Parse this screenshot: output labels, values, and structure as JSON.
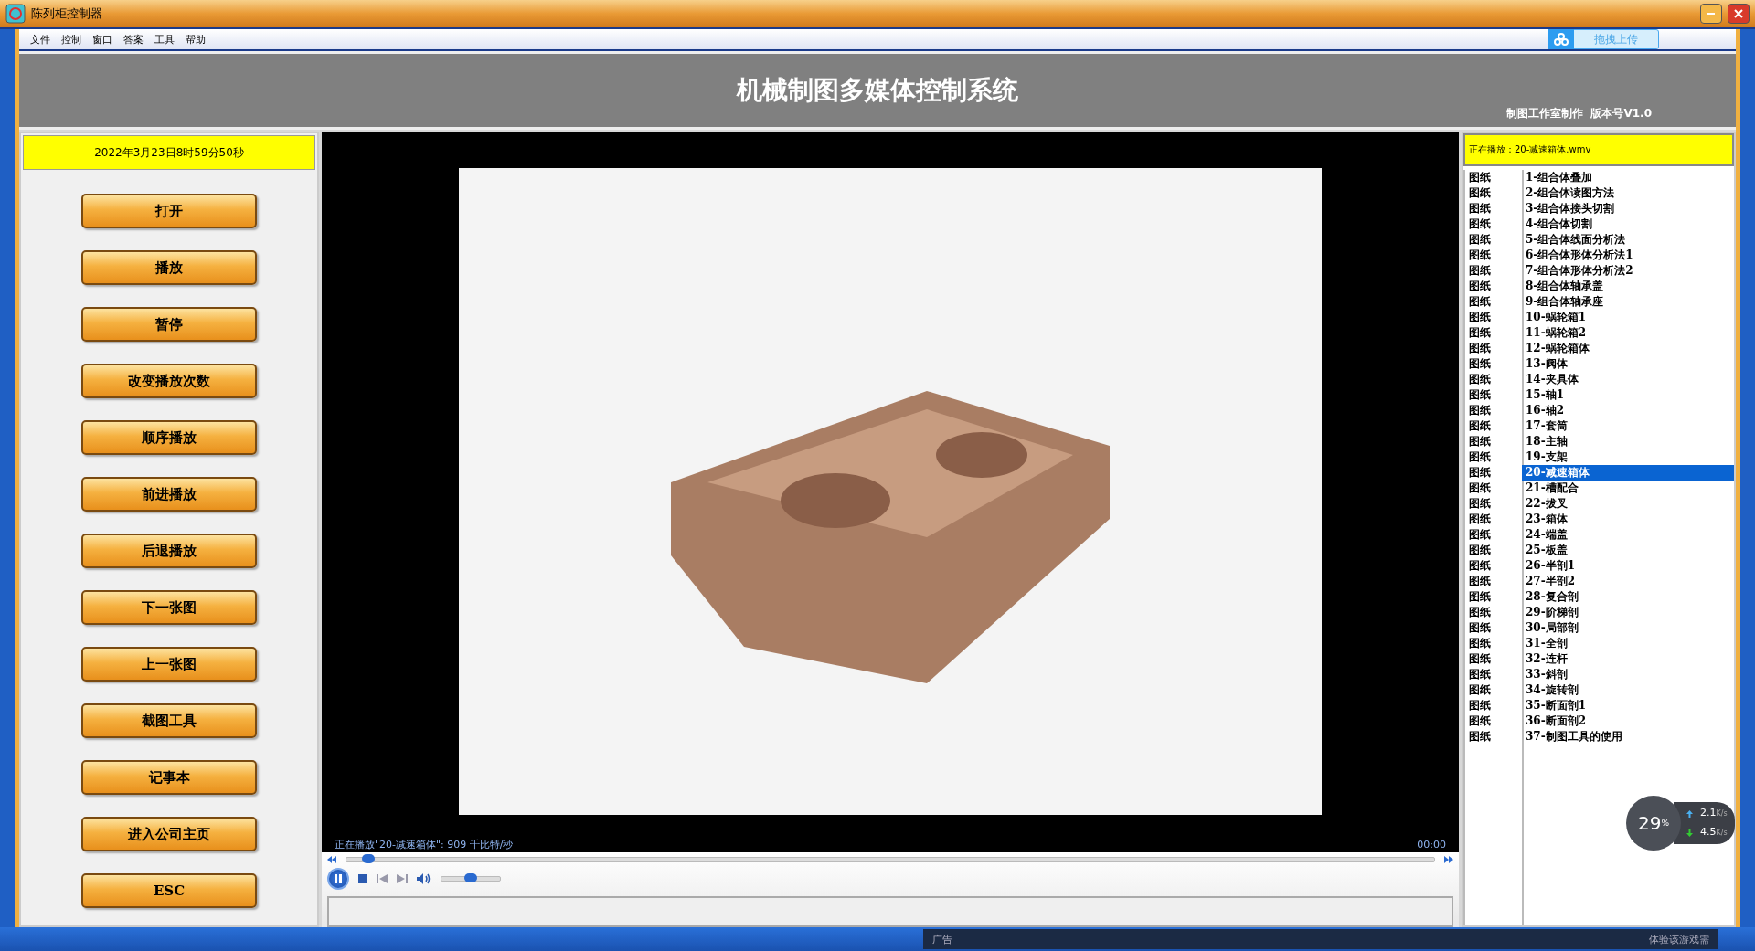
{
  "window": {
    "title": "陈列柜控制器"
  },
  "menu": [
    "文件",
    "控制",
    "窗口",
    "答案",
    "工具",
    "帮助"
  ],
  "upload_button": {
    "label": "拖拽上传"
  },
  "header": {
    "title": "机械制图多媒体控制系统",
    "credit": "制图工作室制作  版本号V1.0"
  },
  "datetime": "2022年3月23日8时59分50秒",
  "buttons": [
    "打开",
    "播放",
    "暂停",
    "改变播放次数",
    "顺序播放",
    "前进播放",
    "后退播放",
    "下一张图",
    "上一张图",
    "截图工具",
    "记事本",
    "进入公司主页",
    "ESC"
  ],
  "now_playing": "正在播放：20-减速箱体.wmv",
  "player": {
    "status": "正在播放\"20-减速箱体\": 909 千比特/秒",
    "time": "00:00",
    "playing": true,
    "seek": {
      "level": 0.02
    },
    "volume": {
      "level": 0.5
    }
  },
  "playlist": [
    {
      "type": "图纸",
      "name": "1-组合体叠加",
      "selected": false
    },
    {
      "type": "图纸",
      "name": "2-组合体读图方法",
      "selected": false
    },
    {
      "type": "图纸",
      "name": "3-组合体接头切割",
      "selected": false
    },
    {
      "type": "图纸",
      "name": "4-组合体切割",
      "selected": false
    },
    {
      "type": "图纸",
      "name": "5-组合体线面分析法",
      "selected": false
    },
    {
      "type": "图纸",
      "name": "6-组合体形体分析法1",
      "selected": false
    },
    {
      "type": "图纸",
      "name": "7-组合体形体分析法2",
      "selected": false
    },
    {
      "type": "图纸",
      "name": "8-组合体轴承盖",
      "selected": false
    },
    {
      "type": "图纸",
      "name": "9-组合体轴承座",
      "selected": false
    },
    {
      "type": "图纸",
      "name": "10-蜗轮箱1",
      "selected": false
    },
    {
      "type": "图纸",
      "name": "11-蜗轮箱2",
      "selected": false
    },
    {
      "type": "图纸",
      "name": "12-蜗轮箱体",
      "selected": false
    },
    {
      "type": "图纸",
      "name": "13-阀体",
      "selected": false
    },
    {
      "type": "图纸",
      "name": "14-夹具体",
      "selected": false
    },
    {
      "type": "图纸",
      "name": "15-轴1",
      "selected": false
    },
    {
      "type": "图纸",
      "name": "16-轴2",
      "selected": false
    },
    {
      "type": "图纸",
      "name": "17-套筒",
      "selected": false
    },
    {
      "type": "图纸",
      "name": "18-主轴",
      "selected": false
    },
    {
      "type": "图纸",
      "name": "19-支架",
      "selected": false
    },
    {
      "type": "图纸",
      "name": "20-减速箱体",
      "selected": true
    },
    {
      "type": "图纸",
      "name": "21-槽配合",
      "selected": false
    },
    {
      "type": "图纸",
      "name": "22-拔叉",
      "selected": false
    },
    {
      "type": "图纸",
      "name": "23-箱体",
      "selected": false
    },
    {
      "type": "图纸",
      "name": "24-端盖",
      "selected": false
    },
    {
      "type": "图纸",
      "name": "25-板盖",
      "selected": false
    },
    {
      "type": "图纸",
      "name": "26-半剖1",
      "selected": false
    },
    {
      "type": "图纸",
      "name": "27-半剖2",
      "selected": false
    },
    {
      "type": "图纸",
      "name": "28-复合剖",
      "selected": false
    },
    {
      "type": "图纸",
      "name": "29-阶梯剖",
      "selected": false
    },
    {
      "type": "图纸",
      "name": "30-局部剖",
      "selected": false
    },
    {
      "type": "图纸",
      "name": "31-全剖",
      "selected": false
    },
    {
      "type": "图纸",
      "name": "32-连杆",
      "selected": false
    },
    {
      "type": "图纸",
      "name": "33-斜剖",
      "selected": false
    },
    {
      "type": "图纸",
      "name": "34-旋转剖",
      "selected": false
    },
    {
      "type": "图纸",
      "name": "35-断面剖1",
      "selected": false
    },
    {
      "type": "图纸",
      "name": "36-断面剖2",
      "selected": false
    },
    {
      "type": "图纸",
      "name": "37-制图工具的使用",
      "selected": false
    }
  ],
  "net_widget": {
    "percent": "29",
    "percent_unit": "%",
    "up": "2.1",
    "up_unit": "K/s",
    "down": "4.5",
    "down_unit": "K/s"
  },
  "taskbar": {
    "ad_label": "广告",
    "ad_text": "体验该游戏需"
  }
}
